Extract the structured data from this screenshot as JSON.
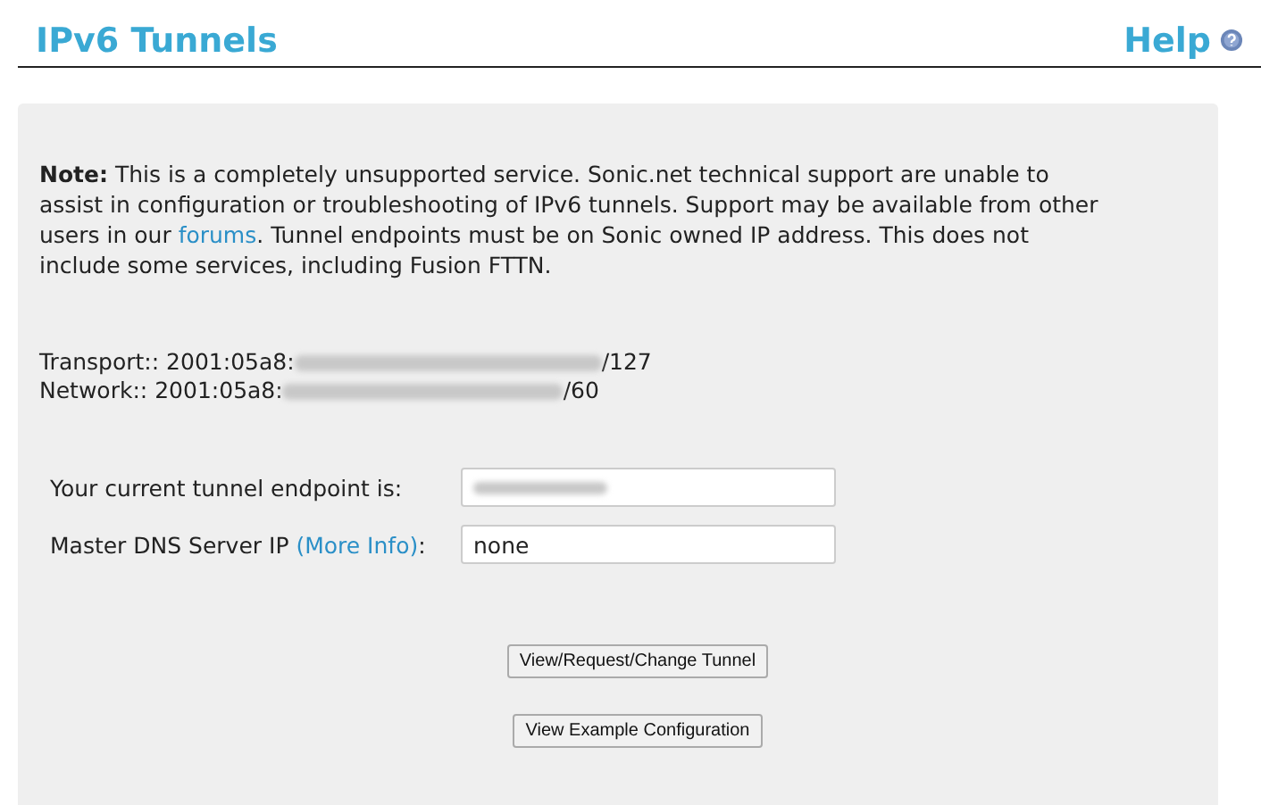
{
  "header": {
    "title": "IPv6 Tunnels",
    "help": "Help"
  },
  "notice": {
    "label": "Note:",
    "before": "This is a completely unsupported service. Sonic.net technical support are unable to assist in configuration or troubleshooting of IPv6 tunnels. Support may be available from other users in our ",
    "link": "forums",
    "after": ". Tunnel endpoints must be on Sonic owned IP address. This does not include some services, including Fusion FTTN."
  },
  "addresses": [
    {
      "label": "Transport:: 2001:05a8:",
      "suffix": "/127"
    },
    {
      "label": "Network:: 2001:05a8:",
      "suffix": "/60"
    }
  ],
  "form": {
    "endpoint_label": "Your current tunnel endpoint is:",
    "dns_label": "Master DNS Server IP ",
    "dns_link": "(More Info)",
    "dns_colon": ":",
    "dns_value": "none"
  },
  "buttons": [
    "View/Request/Change Tunnel",
    "View Example Configuration"
  ]
}
